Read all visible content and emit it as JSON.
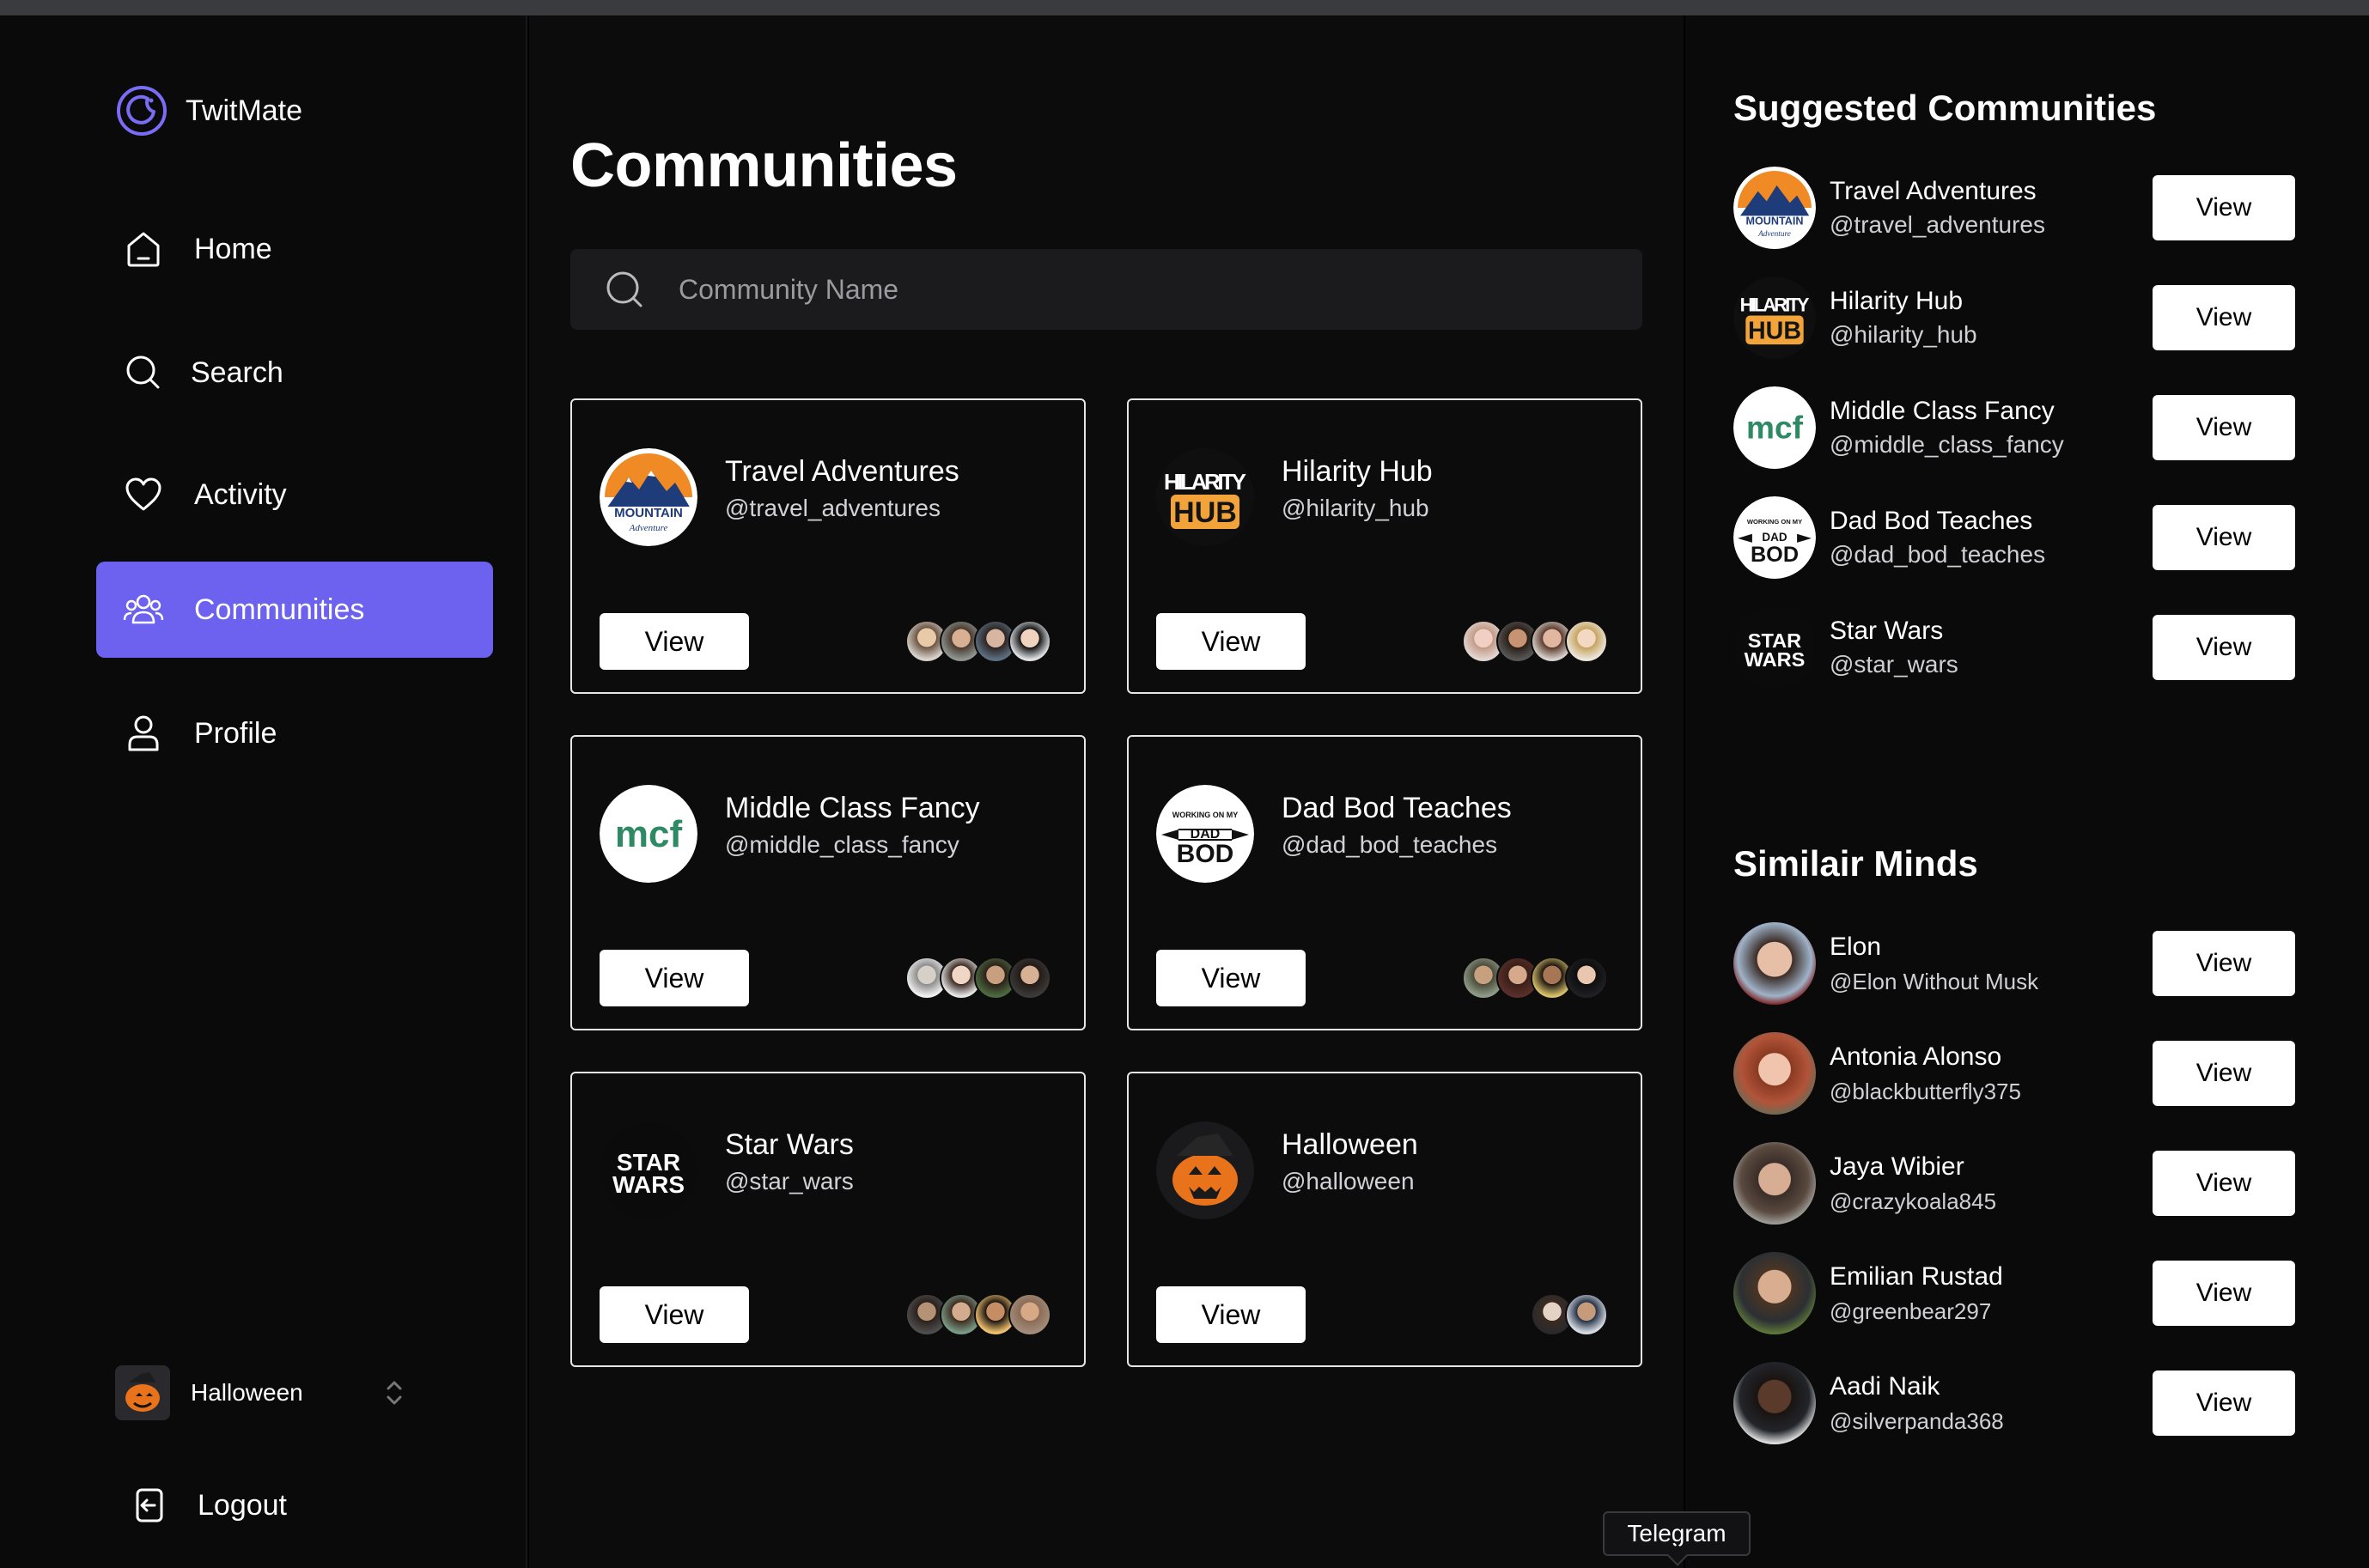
{
  "app": {
    "name": "TwitMate"
  },
  "nav": [
    {
      "label": "Home",
      "icon": "home-icon"
    },
    {
      "label": "Search",
      "icon": "search-icon"
    },
    {
      "label": "Activity",
      "icon": "heart-icon"
    },
    {
      "label": "Communities",
      "icon": "users-icon",
      "active": true
    },
    {
      "label": "Profile",
      "icon": "user-icon"
    }
  ],
  "account": {
    "name": "Halloween"
  },
  "logout": {
    "label": "Logout"
  },
  "main": {
    "title": "Communities",
    "search_placeholder": "Community Name",
    "view_label": "View",
    "cards": [
      {
        "name": "Travel Adventures",
        "handle": "@travel_adventures",
        "logo": "mountain"
      },
      {
        "name": "Hilarity Hub",
        "handle": "@hilarity_hub",
        "logo": "hub"
      },
      {
        "name": "Middle Class Fancy",
        "handle": "@middle_class_fancy",
        "logo": "mcf"
      },
      {
        "name": "Dad Bod Teaches",
        "handle": "@dad_bod_teaches",
        "logo": "dadbod"
      },
      {
        "name": "Star Wars",
        "handle": "@star_wars",
        "logo": "starwars"
      },
      {
        "name": "Halloween",
        "handle": "@halloween",
        "logo": "pumpkin"
      }
    ]
  },
  "logo_text": {
    "mountain": "MOUNTAIN",
    "mountain_sub": "Adventure",
    "hilarity": "HILARITY",
    "hub": "HUB",
    "mcf": "mcf",
    "dad_top": "WORKING ON MY",
    "dad": "DAD",
    "bod": "BOD",
    "star": "STAR",
    "wars": "WARS"
  },
  "suggested": {
    "title": "Suggested Communities",
    "items": [
      {
        "name": "Travel Adventures",
        "handle": "@travel_adventures"
      },
      {
        "name": "Hilarity Hub",
        "handle": "@hilarity_hub"
      },
      {
        "name": "Middle Class Fancy",
        "handle": "@middle_class_fancy"
      },
      {
        "name": "Dad Bod Teaches",
        "handle": "@dad_bod_teaches"
      },
      {
        "name": "Star Wars",
        "handle": "@star_wars"
      }
    ]
  },
  "similar": {
    "title": "Similair Minds",
    "items": [
      {
        "name": "Elon",
        "handle": "@Elon Without Musk"
      },
      {
        "name": "Antonia Alonso",
        "handle": "@blackbutterfly375"
      },
      {
        "name": "Jaya Wibier",
        "handle": "@crazykoala845"
      },
      {
        "name": "Emilian Rustad",
        "handle": "@greenbear297"
      },
      {
        "name": "Aadi Naik",
        "handle": "@silverpanda368"
      }
    ]
  },
  "tooltip": {
    "label": "Telegram"
  },
  "colors": {
    "accent": "#6d62f0",
    "background": "#0c0c0d",
    "card_border": "#e6e6e6"
  }
}
